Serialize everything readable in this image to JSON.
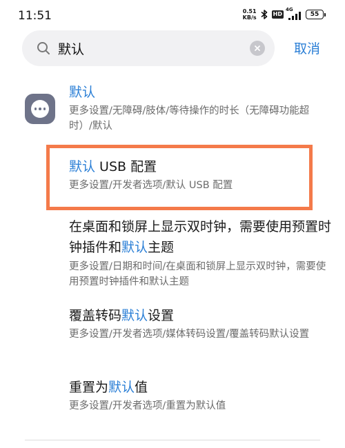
{
  "status_bar": {
    "time": "11:51",
    "net_speed_value": "0.51",
    "net_speed_unit": "KB/s",
    "hd_badge": "HD",
    "network": "4G",
    "battery": "55"
  },
  "search": {
    "query": "默认",
    "cancel_label": "取消"
  },
  "results": [
    {
      "title_pre": "",
      "title_hl": "默认",
      "title_post": "",
      "path": "更多设置/无障碍/肢体/等待操作的时长（无障碍功能超时）/默认"
    },
    {
      "title_pre": "",
      "title_hl": "默认",
      "title_post": " USB 配置",
      "path": "更多设置/开发者选项/默认 USB 配置"
    },
    {
      "title_pre": "在桌面和锁屏上显示双时钟，需要使用预置时钟插件和",
      "title_hl": "默认",
      "title_post": "主题",
      "path": "更多设置/日期和时间/在桌面和锁屏上显示双时钟，需要使用预置时钟插件和默认主题"
    },
    {
      "title_pre": "覆盖转码",
      "title_hl": "默认",
      "title_post": "设置",
      "path": "更多设置/开发者选项/媒体转码设置/覆盖转码默认设置"
    },
    {
      "title_pre": "重置为",
      "title_hl": "默认",
      "title_post": "值",
      "path": "更多设置/开发者选项/重置为默认值"
    }
  ],
  "colors": {
    "accent": "#2b7fd6",
    "highlight_border": "#f47a4a",
    "app_icon_bg": "#6e7389"
  }
}
